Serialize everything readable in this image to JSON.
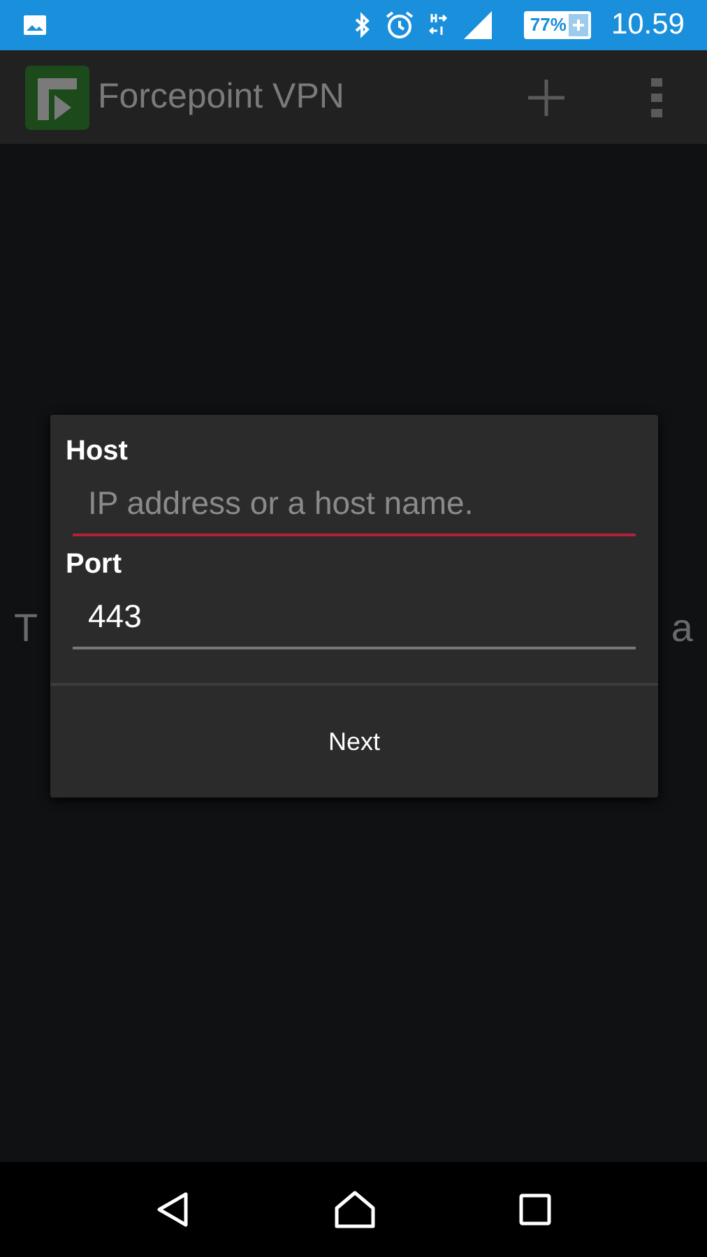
{
  "status_bar": {
    "battery": "77%",
    "time": "10.59"
  },
  "app_bar": {
    "title": "Forcepoint VPN"
  },
  "background_text": [
    "T",
    "a"
  ],
  "dialog": {
    "fields": [
      {
        "label": "Host",
        "placeholder": "IP address or a host name.",
        "error": true
      },
      {
        "label": "Port",
        "value": "443",
        "error": false
      }
    ],
    "button": "Next"
  }
}
